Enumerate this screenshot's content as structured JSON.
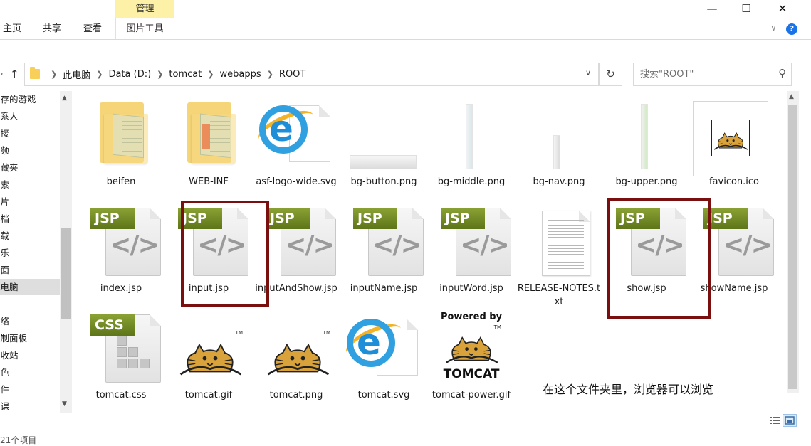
{
  "ribbon": {
    "tabs": [
      "主页",
      "共享",
      "查看"
    ],
    "contextual_group": "管理",
    "contextual_tab": "图片工具",
    "help": "?"
  },
  "window_controls": {
    "minimize": "—",
    "maximize": "☐",
    "close": "✕"
  },
  "address": {
    "crumbs": [
      "此电脑",
      "Data (D:)",
      "tomcat",
      "webapps",
      "ROOT"
    ]
  },
  "search": {
    "placeholder": "搜索\"ROOT\""
  },
  "sidebar": {
    "items": [
      {
        "label": "保存的游戏"
      },
      {
        "label": "联系人"
      },
      {
        "label": "链接"
      },
      {
        "label": "视频"
      },
      {
        "label": "收藏夹"
      },
      {
        "label": "搜索"
      },
      {
        "label": "图片"
      },
      {
        "label": "文档"
      },
      {
        "label": "下载"
      },
      {
        "label": "音乐"
      },
      {
        "label": "桌面"
      },
      {
        "label": "此电脑",
        "selected": true
      },
      {
        "label": ""
      },
      {
        "label": "网络"
      },
      {
        "label": "控制面板"
      },
      {
        "label": "回收站"
      },
      {
        "label": "颜色"
      },
      {
        "label": "文件"
      },
      {
        "label": "家课"
      }
    ]
  },
  "files": [
    {
      "name": "beifen",
      "type": "folder"
    },
    {
      "name": "WEB-INF",
      "type": "folder-red"
    },
    {
      "name": "asf-logo-wide.svg",
      "type": "ie"
    },
    {
      "name": "bg-button.png",
      "type": "bar-h"
    },
    {
      "name": "bg-middle.png",
      "type": "bar-v"
    },
    {
      "name": "bg-nav.png",
      "type": "bar-v-short"
    },
    {
      "name": "bg-upper.png",
      "type": "bar-v-green"
    },
    {
      "name": "favicon.ico",
      "type": "favicon"
    },
    {
      "name": "index.jsp",
      "type": "jsp",
      "badge": "JSP"
    },
    {
      "name": "input.jsp",
      "type": "jsp",
      "badge": "JSP"
    },
    {
      "name": "inputAndShow.jsp",
      "type": "jsp",
      "badge": "JSP"
    },
    {
      "name": "inputName.jsp",
      "type": "jsp",
      "badge": "JSP"
    },
    {
      "name": "inputWord.jsp",
      "type": "jsp",
      "badge": "JSP"
    },
    {
      "name": "RELEASE-NOTES.txt",
      "type": "txt"
    },
    {
      "name": "show.jsp",
      "type": "jsp",
      "badge": "JSP"
    },
    {
      "name": "showName.jsp",
      "type": "jsp",
      "badge": "JSP"
    },
    {
      "name": "tomcat.css",
      "type": "css",
      "badge": "CSS"
    },
    {
      "name": "tomcat.gif",
      "type": "tomcat"
    },
    {
      "name": "tomcat.png",
      "type": "tomcat"
    },
    {
      "name": "tomcat.svg",
      "type": "ie"
    },
    {
      "name": "tomcat-power.gif",
      "type": "power",
      "powered": "Powered by",
      "brand": "TOMCAT",
      "tm": "TM"
    }
  ],
  "annotation": {
    "text": "在这个文件夹里，浏览器可以浏览"
  },
  "code_glyph": "</>",
  "ie_glyph": "e",
  "status": {
    "text": "21个项目"
  },
  "colors": {
    "annotation_border": "#7a0f0f",
    "jsp_badge": "#6f8a22",
    "manage_tab": "#fdf1a7",
    "folder": "#f7cf59"
  }
}
